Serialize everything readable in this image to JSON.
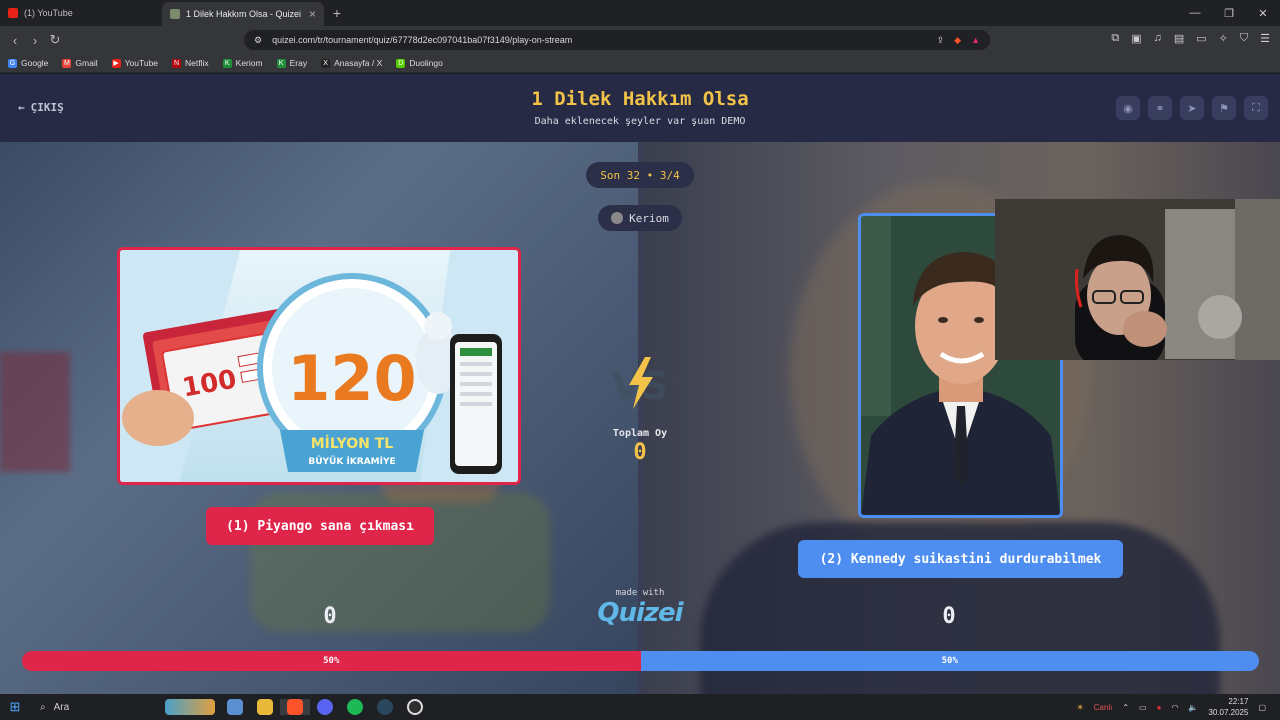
{
  "browser": {
    "tabs": [
      {
        "title": "(1) YouTube",
        "active": false,
        "favicon_color": "#e62117"
      },
      {
        "title": "1 Dilek Hakkım Olsa - Quizei",
        "active": true,
        "favicon_color": "#7b8a6a"
      }
    ],
    "new_tab_glyph": "+",
    "url": "quizei.com/tr/tournament/quiz/67778d2ec097041ba07f3149/play-on-stream",
    "bookmarks": [
      {
        "label": "Google",
        "color": "#4285f4",
        "glyph": "G"
      },
      {
        "label": "Gmail",
        "color": "#ea4335",
        "glyph": "M"
      },
      {
        "label": "YouTube",
        "color": "#e62117",
        "glyph": "▶"
      },
      {
        "label": "Netflix",
        "color": "#b20710",
        "glyph": "N"
      },
      {
        "label": "Keriom",
        "color": "#1f8f3a",
        "glyph": "K"
      },
      {
        "label": "Eray",
        "color": "#1f8f3a",
        "glyph": "K"
      },
      {
        "label": "Anasayfa / X",
        "color": "#222222",
        "glyph": "X"
      },
      {
        "label": "Duolingo",
        "color": "#58cc02",
        "glyph": "D"
      }
    ]
  },
  "header": {
    "exit_label": "ÇIKIŞ",
    "title": "1 Dilek Hakkım Olsa",
    "subtitle": "Daha eklenecek şeyler var şuan DEMO",
    "accent": "#f2c348"
  },
  "round": {
    "label": "Son 32 • 3/4"
  },
  "streamer": {
    "name": "Keriom"
  },
  "option1": {
    "label": "(1) Piyango sana çıkması",
    "color": "#e0254a",
    "image_text": {
      "amount": "120",
      "unit": "MİLYON TL",
      "caption": "BÜYÜK İKRAMİYE",
      "ticket": "100"
    },
    "votes": "0"
  },
  "option2": {
    "label": "(2) Kennedy suikastini durdurabilmek",
    "color": "#4e8ef0",
    "votes": "0"
  },
  "vs": {
    "glyph": "VS"
  },
  "total": {
    "label": "Toplam Oy",
    "value": "0"
  },
  "branding": {
    "made_with": "made with",
    "brand": "Quizei"
  },
  "progress": {
    "left_pct": "50%",
    "right_pct": "50%",
    "left_fraction": 0.5
  },
  "taskbar": {
    "search_label": "Ara",
    "weather": "Canlı",
    "time": "22:17",
    "date": "30.07.2025"
  }
}
